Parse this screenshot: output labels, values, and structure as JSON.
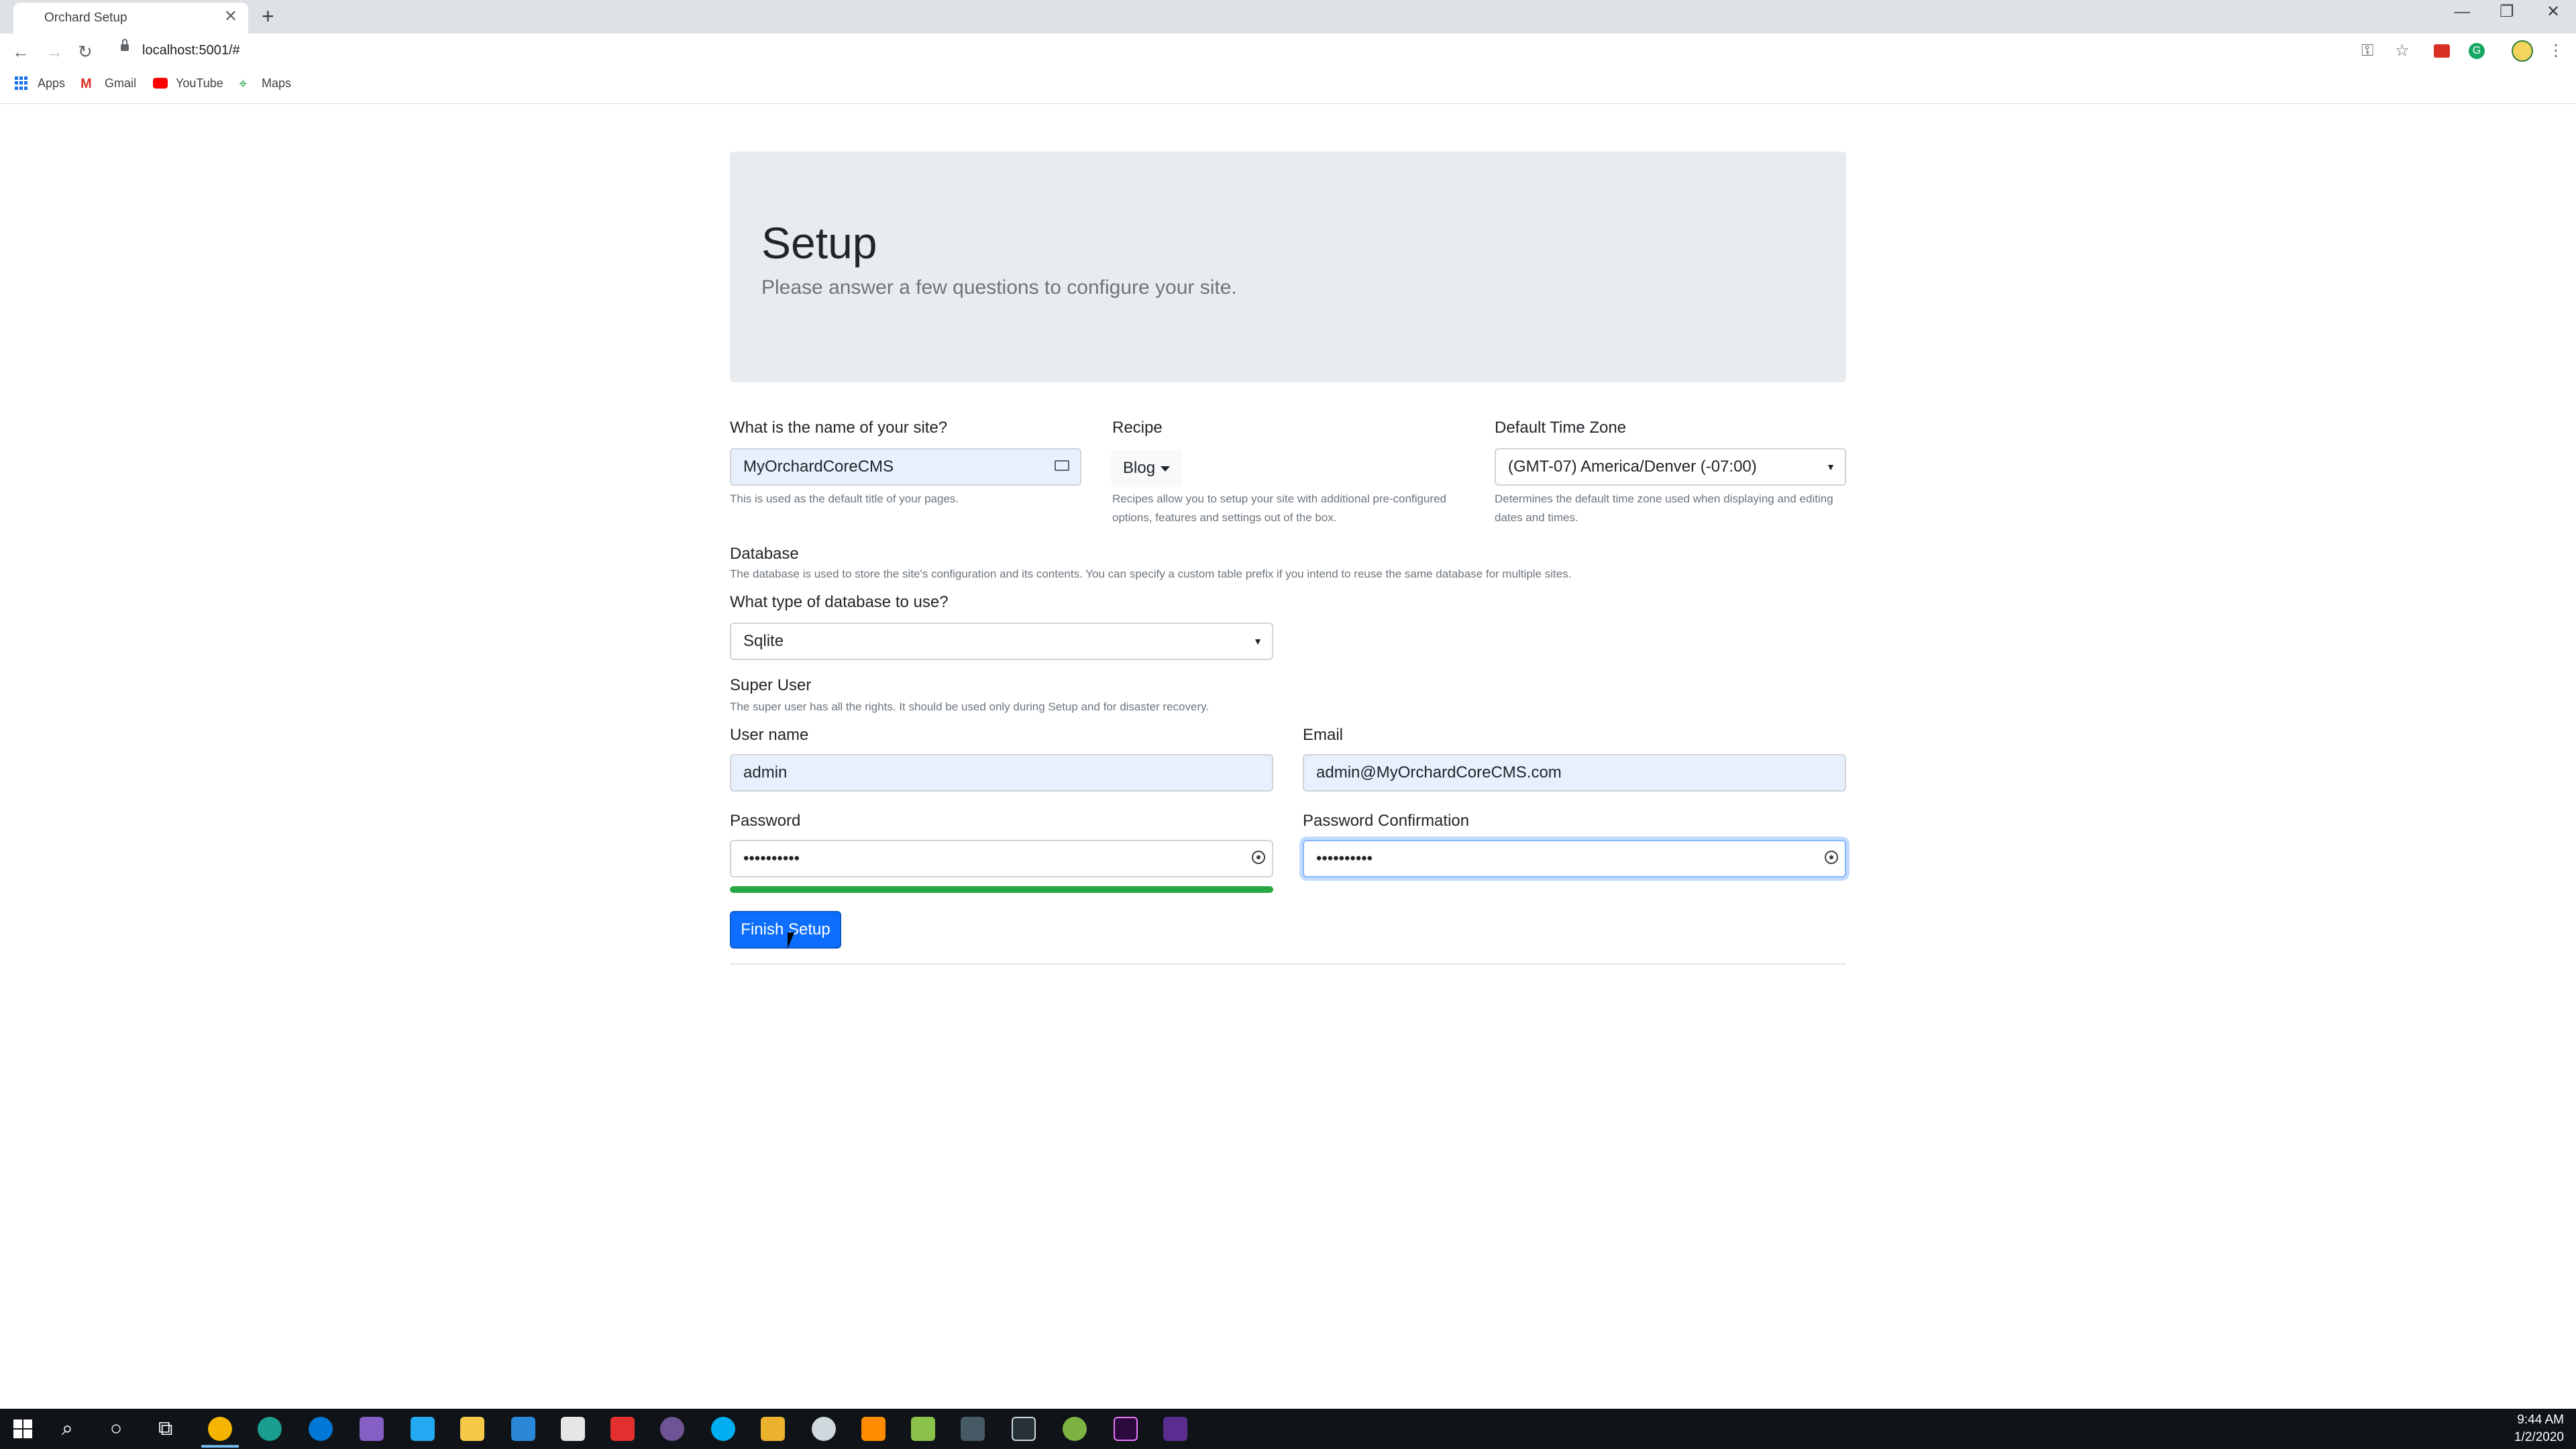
{
  "browser": {
    "tab_title": "Orchard Setup",
    "tab_close": "✕",
    "new_tab": "+",
    "url": "localhost:5001/#",
    "window_controls": [
      "—",
      "❐",
      "✕"
    ],
    "icons": [
      "back-icon",
      "forward-icon",
      "reload-icon",
      "lock-icon",
      "key-icon",
      "star-icon",
      "menu-icon"
    ],
    "bookmarks": [
      "Apps",
      "Gmail",
      "YouTube",
      "Maps"
    ]
  },
  "page": {
    "title": "Setup",
    "lead": "Please answer a few questions to configure your site.",
    "site_name": {
      "label": "What is the name of your site?",
      "value": "MyOrchardCoreCMS",
      "help": "This is used as the default title of your pages."
    },
    "recipe": {
      "label": "Recipe",
      "value": "Blog",
      "help": "Recipes allow you to setup your site with additional pre-configured options, features and settings out of the box."
    },
    "timezone": {
      "label": "Default Time Zone",
      "value": "(GMT-07) America/Denver (-07:00)",
      "help": "Determines the default time zone used when displaying and editing dates and times."
    },
    "database": {
      "title": "Database",
      "help": "The database is used to store the site's configuration and its contents. You can specify a custom table prefix if you intend to reuse the same database for multiple sites.",
      "type_label": "What type of database to use?",
      "type_value": "Sqlite"
    },
    "super_user": {
      "title": "Super User",
      "help": "The super user has all the rights. It should be used only during Setup and for disaster recovery.",
      "username_label": "User name",
      "username_value": "admin",
      "email_label": "Email",
      "email_value": "admin@MyOrchardCoreCMS.com",
      "password_label": "Password",
      "password_value": "••••••••••",
      "password_confirm_label": "Password Confirmation",
      "password_confirm_value": "••••••••••",
      "password_strength": 1.0,
      "strength_color": "#28a745"
    },
    "finish_button": "Finish Setup"
  },
  "taskbar": {
    "time": "9:44 AM",
    "date": "1/2/2020",
    "apps": [
      "search-icon",
      "cortana-icon",
      "task-view-icon",
      "chrome-icon",
      "edge-beta-icon",
      "edge-icon",
      "visual-studio-icon",
      "vscode-icon",
      "file-explorer-icon",
      "store-icon",
      "mail-icon",
      "app-red-icon",
      "github-icon",
      "skype-icon",
      "slack-icon",
      "app-clock-icon",
      "app-orange-icon",
      "app-game-icon",
      "app-terminal-icon",
      "app-window-icon",
      "app-green-icon",
      "premiere-icon",
      "app-purple-icon"
    ]
  }
}
